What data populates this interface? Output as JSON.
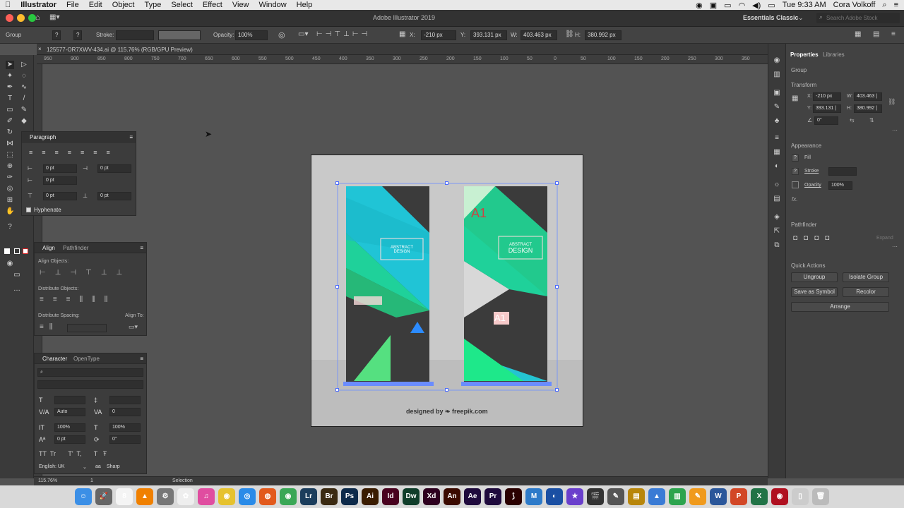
{
  "menubar": {
    "apple": "",
    "app": "Illustrator",
    "items": [
      "File",
      "Edit",
      "Object",
      "Type",
      "Select",
      "Effect",
      "View",
      "Window",
      "Help"
    ],
    "clock": "Tue 9:33 AM",
    "user": "Cora Volkoff"
  },
  "titlebar": {
    "title": "Adobe Illustrator 2019",
    "workspace": "Essentials Classic",
    "search_placeholder": "Search Adobe Stock"
  },
  "control": {
    "selection": "Group",
    "stroke_label": "Stroke:",
    "opacity_label": "Opacity:",
    "opacity": "100%",
    "x_label": "X:",
    "x": "-210 px",
    "y_label": "Y:",
    "y": "393.131 px",
    "w_label": "W:",
    "w": "403.463 px",
    "h_label": "H:",
    "h": "380.992 px"
  },
  "document": {
    "tab": "125577-OR7XWV-434.ai @ 115.76% (RGB/GPU Preview)",
    "ruler_ticks": [
      "950",
      "900",
      "850",
      "800",
      "750",
      "700",
      "650",
      "600",
      "550",
      "500",
      "450",
      "400",
      "350",
      "300",
      "250",
      "200",
      "150",
      "100",
      "50",
      "0",
      "50",
      "100",
      "150",
      "200",
      "250",
      "300",
      "350"
    ]
  },
  "paragraph": {
    "title": "Paragraph",
    "indent_left": "0 pt",
    "indent_right": "0 pt",
    "first_line": "0 pt",
    "space_before": "0 pt",
    "space_after": "0 pt",
    "hyphenate": "Hyphenate"
  },
  "align": {
    "tab1": "Align",
    "tab2": "Pathfinder",
    "align_objects": "Align Objects:",
    "distribute_objects": "Distribute Objects:",
    "distribute_spacing": "Distribute Spacing:",
    "align_to": "Align To:"
  },
  "character": {
    "tab1": "Character",
    "tab2": "OpenType",
    "leading": "Auto",
    "tracking": "0",
    "vscale": "100%",
    "hscale": "100%",
    "baseline": "0 pt",
    "rotate": "0°",
    "tt1": "TT",
    "tt2": "Tr",
    "tt3": "T'",
    "tt4": "T,",
    "tt5": "T",
    "tt6": "Ŧ",
    "language": "English: UK",
    "antialias": "Sharp"
  },
  "artwork": {
    "banner1_title_line1": "ABSTRACT",
    "banner1_title_line2": "DESIGN",
    "banner2_title_line1": "ABSTRACT",
    "banner2_title_line2": "DESIGN",
    "a1": "A1",
    "a1b": "A1",
    "credit": "designed by ❧ freepik.com"
  },
  "properties": {
    "tab1": "Properties",
    "tab2": "Libraries",
    "object": "Group",
    "transform": "Transform",
    "x_label": "X:",
    "x": "-210 px",
    "y_label": "Y:",
    "y": "393.131 |",
    "w_label": "W:",
    "w": "403.463 |",
    "h_label": "H:",
    "h": "380.992 |",
    "angle": "0°",
    "appearance": "Appearance",
    "fill": "Fill",
    "stroke": "Stroke",
    "opacity_label": "Opacity",
    "opacity": "100%",
    "fx": "fx.",
    "pathfinder": "Pathfinder",
    "expand": "Expand",
    "quick_actions": "Quick Actions",
    "ungroup": "Ungroup",
    "isolate_group": "Isolate Group",
    "save_as_symbol": "Save as Symbol",
    "recolor": "Recolor",
    "arrange": "Arrange"
  },
  "status": {
    "zoom": "115.76%",
    "page": "1",
    "tool": "Selection"
  },
  "dock": [
    {
      "name": "finder",
      "label": "☺",
      "color": "#3b8fe6"
    },
    {
      "name": "launchpad",
      "label": "🚀",
      "color": "#666"
    },
    {
      "name": "calendar",
      "label": "8",
      "color": "#f4f4f4"
    },
    {
      "name": "vlc",
      "label": "▲",
      "color": "#f08000"
    },
    {
      "name": "system-prefs",
      "label": "⚙",
      "color": "#777"
    },
    {
      "name": "photos",
      "label": "✿",
      "color": "#eee"
    },
    {
      "name": "itunes",
      "label": "♫",
      "color": "#e04da0"
    },
    {
      "name": "cyberduck",
      "label": "◉",
      "color": "#e6c22e"
    },
    {
      "name": "safari",
      "label": "◎",
      "color": "#2a8be8"
    },
    {
      "name": "firefox",
      "label": "◍",
      "color": "#e2591c"
    },
    {
      "name": "chrome",
      "label": "◉",
      "color": "#3aa756"
    },
    {
      "name": "lightroom",
      "label": "Lr",
      "color": "#1b3d5c"
    },
    {
      "name": "bridge",
      "label": "Br",
      "color": "#3b2a12"
    },
    {
      "name": "photoshop",
      "label": "Ps",
      "color": "#0d2a4a"
    },
    {
      "name": "illustrator",
      "label": "Ai",
      "color": "#3a1c00"
    },
    {
      "name": "indesign",
      "label": "Id",
      "color": "#49021f"
    },
    {
      "name": "dreamweaver",
      "label": "Dw",
      "color": "#0f3d2a"
    },
    {
      "name": "xd",
      "label": "Xd",
      "color": "#2e001f"
    },
    {
      "name": "animate",
      "label": "An",
      "color": "#3b0a00"
    },
    {
      "name": "after-effects",
      "label": "Ae",
      "color": "#1f0a3d"
    },
    {
      "name": "premiere",
      "label": "Pr",
      "color": "#1f0a3d"
    },
    {
      "name": "acrobat",
      "label": "⟆",
      "color": "#2a0000"
    },
    {
      "name": "mail",
      "label": "M",
      "color": "#2d7ac9"
    },
    {
      "name": "onepassword",
      "label": "◐",
      "color": "#1a4fa3"
    },
    {
      "name": "imovie",
      "label": "★",
      "color": "#6a3fcc"
    },
    {
      "name": "final-cut",
      "label": "🎬",
      "color": "#333"
    },
    {
      "name": "motion",
      "label": "✎",
      "color": "#555"
    },
    {
      "name": "compressor",
      "label": "▤",
      "color": "#b8860b"
    },
    {
      "name": "keynote",
      "label": "▲",
      "color": "#3a7bd5"
    },
    {
      "name": "numbers",
      "label": "▥",
      "color": "#2da44e"
    },
    {
      "name": "pages",
      "label": "✎",
      "color": "#f09a1c"
    },
    {
      "name": "word",
      "label": "W",
      "color": "#2b579a"
    },
    {
      "name": "powerpoint",
      "label": "P",
      "color": "#d24726"
    },
    {
      "name": "excel",
      "label": "X",
      "color": "#217346"
    },
    {
      "name": "photobooth",
      "label": "◉",
      "color": "#b01020"
    },
    {
      "name": "document",
      "label": "▯",
      "color": "#ccc"
    },
    {
      "name": "trash",
      "label": "🗑",
      "color": "#bbb"
    }
  ]
}
